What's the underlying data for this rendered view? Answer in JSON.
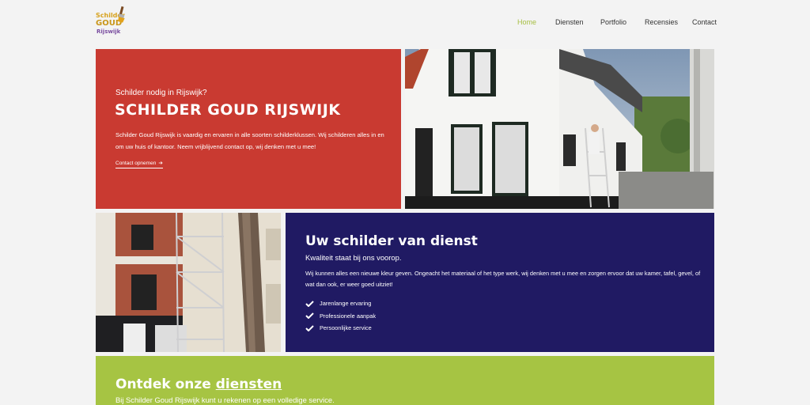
{
  "brand": {
    "logo_line1": "Schilder",
    "logo_line2": "GOUD",
    "logo_line3": "Rijswijk"
  },
  "nav": {
    "items": [
      {
        "label": "Home",
        "active": true
      },
      {
        "label": "Diensten",
        "active": false
      },
      {
        "label": "Portfolio",
        "active": false
      },
      {
        "label": "Recensies",
        "active": false
      },
      {
        "label": "Contact",
        "active": false
      }
    ]
  },
  "hero": {
    "kicker": "Schilder nodig in Rijswijk?",
    "title": "SCHILDER GOUD RIJSWIJK",
    "body": "Schilder Goud Rijswijk is vaardig en ervaren in alle soorten schilderklussen. Wij schilderen alles in en om uw huis of kantoor. Neem vrijblijvend contact op, wij denken met u mee!",
    "cta": "Contact opnemen",
    "arrow": "➔"
  },
  "service": {
    "title": "Uw schilder van dienst",
    "subtitle": "Kwaliteit staat bij ons voorop.",
    "body": "Wij kunnen alles een nieuwe kleur geven. Ongeacht het materiaal of het type werk, wij denken met u mee en zorgen ervoor dat uw kamer, tafel, gevel, of wat dan ook, er weer goed uitziet!",
    "features": [
      "Jarenlange ervaring",
      "Professionele aanpak",
      "Persoonlijke service"
    ]
  },
  "diensten": {
    "title_prefix": "Ontdek onze ",
    "title_link": "diensten",
    "subtitle": "Bij Schilder Goud Rijswijk kunt u rekenen op een volledige service."
  },
  "colors": {
    "red": "#c93a31",
    "navy": "#201a63",
    "green": "#a6c443",
    "nav_active": "#a6be42",
    "background": "#f3f3f3"
  },
  "icons": [
    "paintbrush-icon",
    "arrow-right-icon",
    "check-icon"
  ]
}
